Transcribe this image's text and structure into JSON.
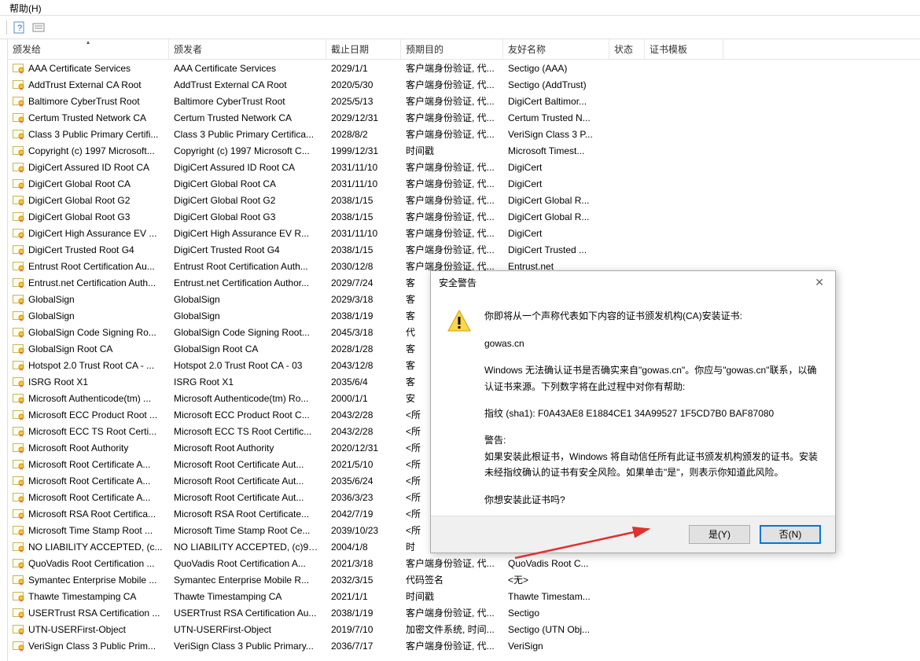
{
  "menu": {
    "help": "帮助(H)"
  },
  "columns": {
    "issued_to": "颁发给",
    "issued_by": "颁发者",
    "expiry": "截止日期",
    "purpose": "预期目的",
    "friendly": "友好名称",
    "status": "状态",
    "template": "证书模板"
  },
  "rows": [
    {
      "to": "AAA Certificate Services",
      "by": "AAA Certificate Services",
      "exp": "2029/1/1",
      "pur": "客户端身份验证, 代...",
      "fr": "Sectigo (AAA)"
    },
    {
      "to": "AddTrust External CA Root",
      "by": "AddTrust External CA Root",
      "exp": "2020/5/30",
      "pur": "客户端身份验证, 代...",
      "fr": "Sectigo (AddTrust)"
    },
    {
      "to": "Baltimore CyberTrust Root",
      "by": "Baltimore CyberTrust Root",
      "exp": "2025/5/13",
      "pur": "客户端身份验证, 代...",
      "fr": "DigiCert Baltimor..."
    },
    {
      "to": "Certum Trusted Network CA",
      "by": "Certum Trusted Network CA",
      "exp": "2029/12/31",
      "pur": "客户端身份验证, 代...",
      "fr": "Certum Trusted N..."
    },
    {
      "to": "Class 3 Public Primary Certifi...",
      "by": "Class 3 Public Primary Certifica...",
      "exp": "2028/8/2",
      "pur": "客户端身份验证, 代...",
      "fr": "VeriSign Class 3 P..."
    },
    {
      "to": "Copyright (c) 1997 Microsoft...",
      "by": "Copyright (c) 1997 Microsoft C...",
      "exp": "1999/12/31",
      "pur": "时间戳",
      "fr": "Microsoft Timest..."
    },
    {
      "to": "DigiCert Assured ID Root CA",
      "by": "DigiCert Assured ID Root CA",
      "exp": "2031/11/10",
      "pur": "客户端身份验证, 代...",
      "fr": "DigiCert"
    },
    {
      "to": "DigiCert Global Root CA",
      "by": "DigiCert Global Root CA",
      "exp": "2031/11/10",
      "pur": "客户端身份验证, 代...",
      "fr": "DigiCert"
    },
    {
      "to": "DigiCert Global Root G2",
      "by": "DigiCert Global Root G2",
      "exp": "2038/1/15",
      "pur": "客户端身份验证, 代...",
      "fr": "DigiCert Global R..."
    },
    {
      "to": "DigiCert Global Root G3",
      "by": "DigiCert Global Root G3",
      "exp": "2038/1/15",
      "pur": "客户端身份验证, 代...",
      "fr": "DigiCert Global R..."
    },
    {
      "to": "DigiCert High Assurance EV ...",
      "by": "DigiCert High Assurance EV R...",
      "exp": "2031/11/10",
      "pur": "客户端身份验证, 代...",
      "fr": "DigiCert"
    },
    {
      "to": "DigiCert Trusted Root G4",
      "by": "DigiCert Trusted Root G4",
      "exp": "2038/1/15",
      "pur": "客户端身份验证, 代...",
      "fr": "DigiCert Trusted ..."
    },
    {
      "to": "Entrust Root Certification Au...",
      "by": "Entrust Root Certification Auth...",
      "exp": "2030/12/8",
      "pur": "客户端身份验证, 代...",
      "fr": "Entrust.net"
    },
    {
      "to": "Entrust.net Certification Auth...",
      "by": "Entrust.net Certification Author...",
      "exp": "2029/7/24",
      "pur": "客",
      "fr": ""
    },
    {
      "to": "GlobalSign",
      "by": "GlobalSign",
      "exp": "2029/3/18",
      "pur": "客",
      "fr": ""
    },
    {
      "to": "GlobalSign",
      "by": "GlobalSign",
      "exp": "2038/1/19",
      "pur": "客",
      "fr": ""
    },
    {
      "to": "GlobalSign Code Signing Ro...",
      "by": "GlobalSign Code Signing Root...",
      "exp": "2045/3/18",
      "pur": "代",
      "fr": ""
    },
    {
      "to": "GlobalSign Root CA",
      "by": "GlobalSign Root CA",
      "exp": "2028/1/28",
      "pur": "客",
      "fr": ""
    },
    {
      "to": "Hotspot 2.0 Trust Root CA - ...",
      "by": "Hotspot 2.0 Trust Root CA - 03",
      "exp": "2043/12/8",
      "pur": "客",
      "fr": ""
    },
    {
      "to": "ISRG Root X1",
      "by": "ISRG Root X1",
      "exp": "2035/6/4",
      "pur": "客",
      "fr": ""
    },
    {
      "to": "Microsoft Authenticode(tm) ...",
      "by": "Microsoft Authenticode(tm) Ro...",
      "exp": "2000/1/1",
      "pur": "安",
      "fr": ""
    },
    {
      "to": "Microsoft ECC Product Root ...",
      "by": "Microsoft ECC Product Root C...",
      "exp": "2043/2/28",
      "pur": "<所",
      "fr": ""
    },
    {
      "to": "Microsoft ECC TS Root Certi...",
      "by": "Microsoft ECC TS Root Certific...",
      "exp": "2043/2/28",
      "pur": "<所",
      "fr": ""
    },
    {
      "to": "Microsoft Root Authority",
      "by": "Microsoft Root Authority",
      "exp": "2020/12/31",
      "pur": "<所",
      "fr": ""
    },
    {
      "to": "Microsoft Root Certificate A...",
      "by": "Microsoft Root Certificate Aut...",
      "exp": "2021/5/10",
      "pur": "<所",
      "fr": ""
    },
    {
      "to": "Microsoft Root Certificate A...",
      "by": "Microsoft Root Certificate Aut...",
      "exp": "2035/6/24",
      "pur": "<所",
      "fr": ""
    },
    {
      "to": "Microsoft Root Certificate A...",
      "by": "Microsoft Root Certificate Aut...",
      "exp": "2036/3/23",
      "pur": "<所",
      "fr": ""
    },
    {
      "to": "Microsoft RSA Root Certifica...",
      "by": "Microsoft RSA Root Certificate...",
      "exp": "2042/7/19",
      "pur": "<所",
      "fr": ""
    },
    {
      "to": "Microsoft Time Stamp Root ...",
      "by": "Microsoft Time Stamp Root Ce...",
      "exp": "2039/10/23",
      "pur": "<所",
      "fr": ""
    },
    {
      "to": "NO LIABILITY ACCEPTED, (c...",
      "by": "NO LIABILITY ACCEPTED, (c)97...",
      "exp": "2004/1/8",
      "pur": "时",
      "fr": ""
    },
    {
      "to": "QuoVadis Root Certification ...",
      "by": "QuoVadis Root Certification A...",
      "exp": "2021/3/18",
      "pur": "客户端身份验证, 代...",
      "fr": "QuoVadis Root C..."
    },
    {
      "to": "Symantec Enterprise Mobile ...",
      "by": "Symantec Enterprise Mobile R...",
      "exp": "2032/3/15",
      "pur": "代码签名",
      "fr": "<无>"
    },
    {
      "to": "Thawte Timestamping CA",
      "by": "Thawte Timestamping CA",
      "exp": "2021/1/1",
      "pur": "时间戳",
      "fr": "Thawte Timestam..."
    },
    {
      "to": "USERTrust RSA Certification ...",
      "by": "USERTrust RSA Certification Au...",
      "exp": "2038/1/19",
      "pur": "客户端身份验证, 代...",
      "fr": "Sectigo"
    },
    {
      "to": "UTN-USERFirst-Object",
      "by": "UTN-USERFirst-Object",
      "exp": "2019/7/10",
      "pur": "加密文件系统, 时间...",
      "fr": "Sectigo (UTN Obj..."
    },
    {
      "to": "VeriSign Class 3 Public Prim...",
      "by": "VeriSign Class 3 Public Primary...",
      "exp": "2036/7/17",
      "pur": "客户端身份验证, 代...",
      "fr": "VeriSign"
    }
  ],
  "dialog": {
    "title": "安全警告",
    "line1": "你即将从一个声称代表如下内容的证书颁发机构(CA)安装证书:",
    "subject": "gowas.cn",
    "line2": "Windows 无法确认证书是否确实来自\"gowas.cn\"。你应与\"gowas.cn\"联系，以确认证书来源。下列数字将在此过程中对你有帮助:",
    "thumb_label": "指纹 (sha1): F0A43AE8 E1884CE1 34A99527 1F5CD7B0 BAF87080",
    "warn_head": "警告:",
    "warn_body": "如果安装此根证书，Windows 将自动信任所有此证书颁发机构颁发的证书。安装未经指纹确认的证书有安全风险。如果单击\"是\"，则表示你知道此风险。",
    "question": "你想安装此证书吗?",
    "yes": "是(Y)",
    "no": "否(N)"
  }
}
